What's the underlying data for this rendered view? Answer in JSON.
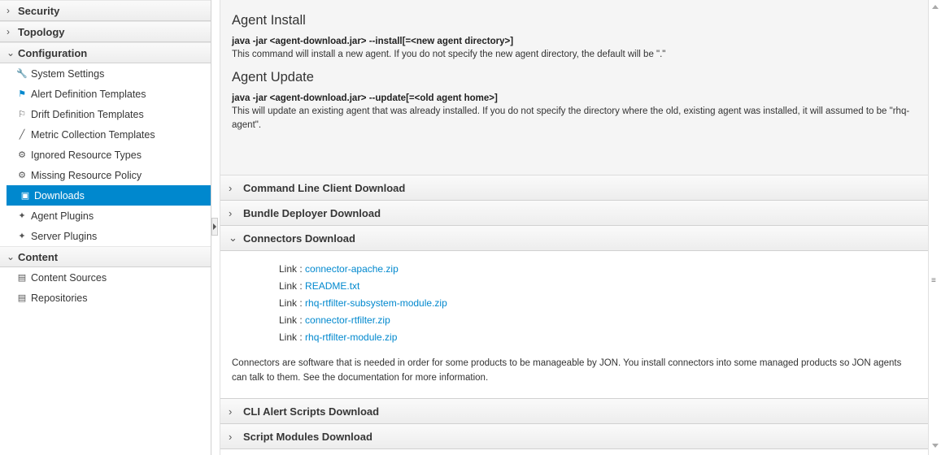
{
  "sidebar": {
    "sections": [
      {
        "label": "Security",
        "expanded": false
      },
      {
        "label": "Topology",
        "expanded": false
      },
      {
        "label": "Configuration",
        "expanded": true
      },
      {
        "label": "Content",
        "expanded": true
      }
    ],
    "config_items": [
      {
        "label": "System Settings",
        "icon": "wrench-icon"
      },
      {
        "label": "Alert Definition Templates",
        "icon": "flag-icon"
      },
      {
        "label": "Drift Definition Templates",
        "icon": "drift-flag-icon"
      },
      {
        "label": "Metric Collection Templates",
        "icon": "pencil-icon"
      },
      {
        "label": "Ignored Resource Types",
        "icon": "gear-icon"
      },
      {
        "label": "Missing Resource Policy",
        "icon": "gear-icon"
      },
      {
        "label": "Downloads",
        "icon": "download-icon",
        "selected": true
      },
      {
        "label": "Agent Plugins",
        "icon": "plugin-icon"
      },
      {
        "label": "Server Plugins",
        "icon": "plugin-icon"
      }
    ],
    "content_items": [
      {
        "label": "Content Sources",
        "icon": "box-icon"
      },
      {
        "label": "Repositories",
        "icon": "box-icon"
      }
    ]
  },
  "main": {
    "install": {
      "title": "Agent Install",
      "cmd": "java -jar <agent-download.jar> --install[=<new agent directory>]",
      "desc": "This command will install a new agent. If you do not specify the new agent directory, the default will be \".\""
    },
    "update": {
      "title": "Agent Update",
      "cmd": "java -jar <agent-download.jar> --update[=<old agent home>]",
      "desc": "This will update an existing agent that was already installed. If you do not specify the directory where the old, existing agent was installed, it will assumed to be \"rhq-agent\"."
    },
    "panels": [
      {
        "label": "Command Line Client Download",
        "expanded": false
      },
      {
        "label": "Bundle Deployer Download",
        "expanded": false
      },
      {
        "label": "Connectors Download",
        "expanded": true
      },
      {
        "label": "CLI Alert Scripts Download",
        "expanded": false
      },
      {
        "label": "Script Modules Download",
        "expanded": false
      }
    ],
    "connectors": {
      "link_prefix": "Link :",
      "links": [
        "connector-apache.zip",
        "README.txt",
        "rhq-rtfilter-subsystem-module.zip",
        "connector-rtfilter.zip",
        "rhq-rtfilter-module.zip"
      ],
      "desc": "Connectors are software that is needed in order for some products to be manageable by JON. You install connectors into some managed products so JON agents can talk to them. See the documentation for more information."
    }
  },
  "colors": {
    "accent": "#0088ce",
    "selected_bg": "#0088ce",
    "info_bg": "#f5f5f5"
  }
}
